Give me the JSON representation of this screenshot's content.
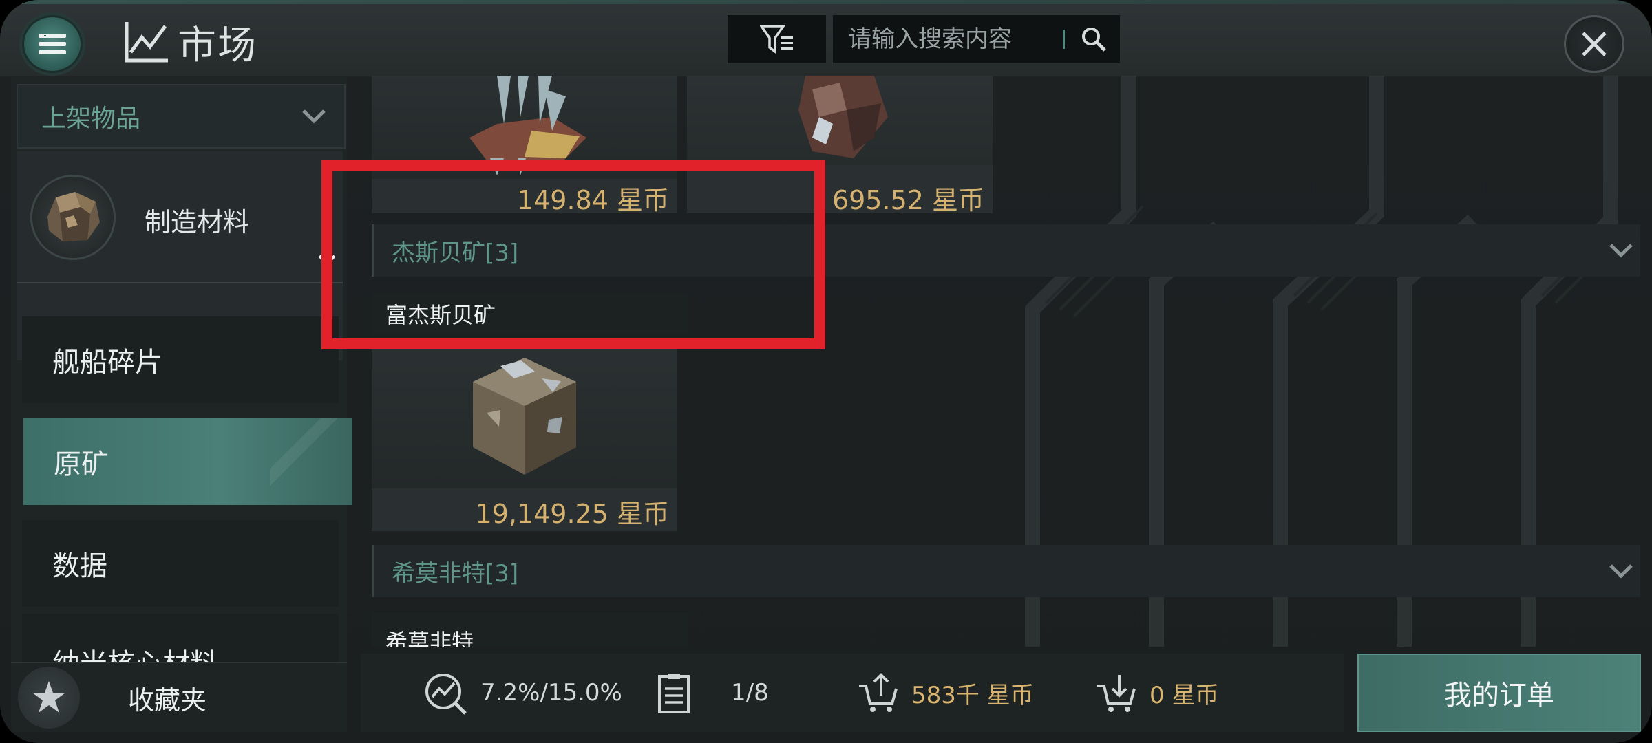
{
  "colors": {
    "accent_teal": "#4c8279",
    "gold_price": "#d6b270",
    "highlight_red": "#e1222a",
    "group_label": "#5f9689"
  },
  "header": {
    "title": "市场",
    "menu_icon": "hamburger-menu-icon",
    "title_icon": "line-chart-icon",
    "filter_icon": "filter-icon",
    "search_placeholder": "请输入搜索内容",
    "search_icon": "search-icon",
    "close_icon": "close-icon"
  },
  "sidebar": {
    "dropdown_label": "上架物品",
    "category": {
      "label": "制造材料",
      "icon": "ore-chunk-icon"
    },
    "items": [
      {
        "label": "舰船碎片",
        "active": false
      },
      {
        "label": "原矿",
        "active": true
      },
      {
        "label": "数据",
        "active": false
      },
      {
        "label": "纳米核心材料",
        "active": false
      }
    ],
    "favorites_label": "收藏夹",
    "favorites_icon": "star-icon"
  },
  "listings": {
    "top_cards": [
      {
        "price": "149.84 星币",
        "icon": "crystal-ore-icon"
      },
      {
        "price": "695.52 星币",
        "icon": "cube-ore-icon"
      }
    ],
    "groups": [
      {
        "label": "杰斯贝矿[3]",
        "subheading": "富杰斯贝矿",
        "cards": [
          {
            "price": "19,149.25 星币",
            "icon": "rock-cube-icon"
          }
        ]
      },
      {
        "label": "希莫非特[3]",
        "subheading": "希莫非特",
        "cards": []
      }
    ]
  },
  "bottom_bar": {
    "tax_rate": "7.2%/15.0%",
    "order_count": "1/8",
    "sell_total": "583千 星币",
    "buy_total": "0 星币",
    "my_orders_label": "我的订单"
  }
}
